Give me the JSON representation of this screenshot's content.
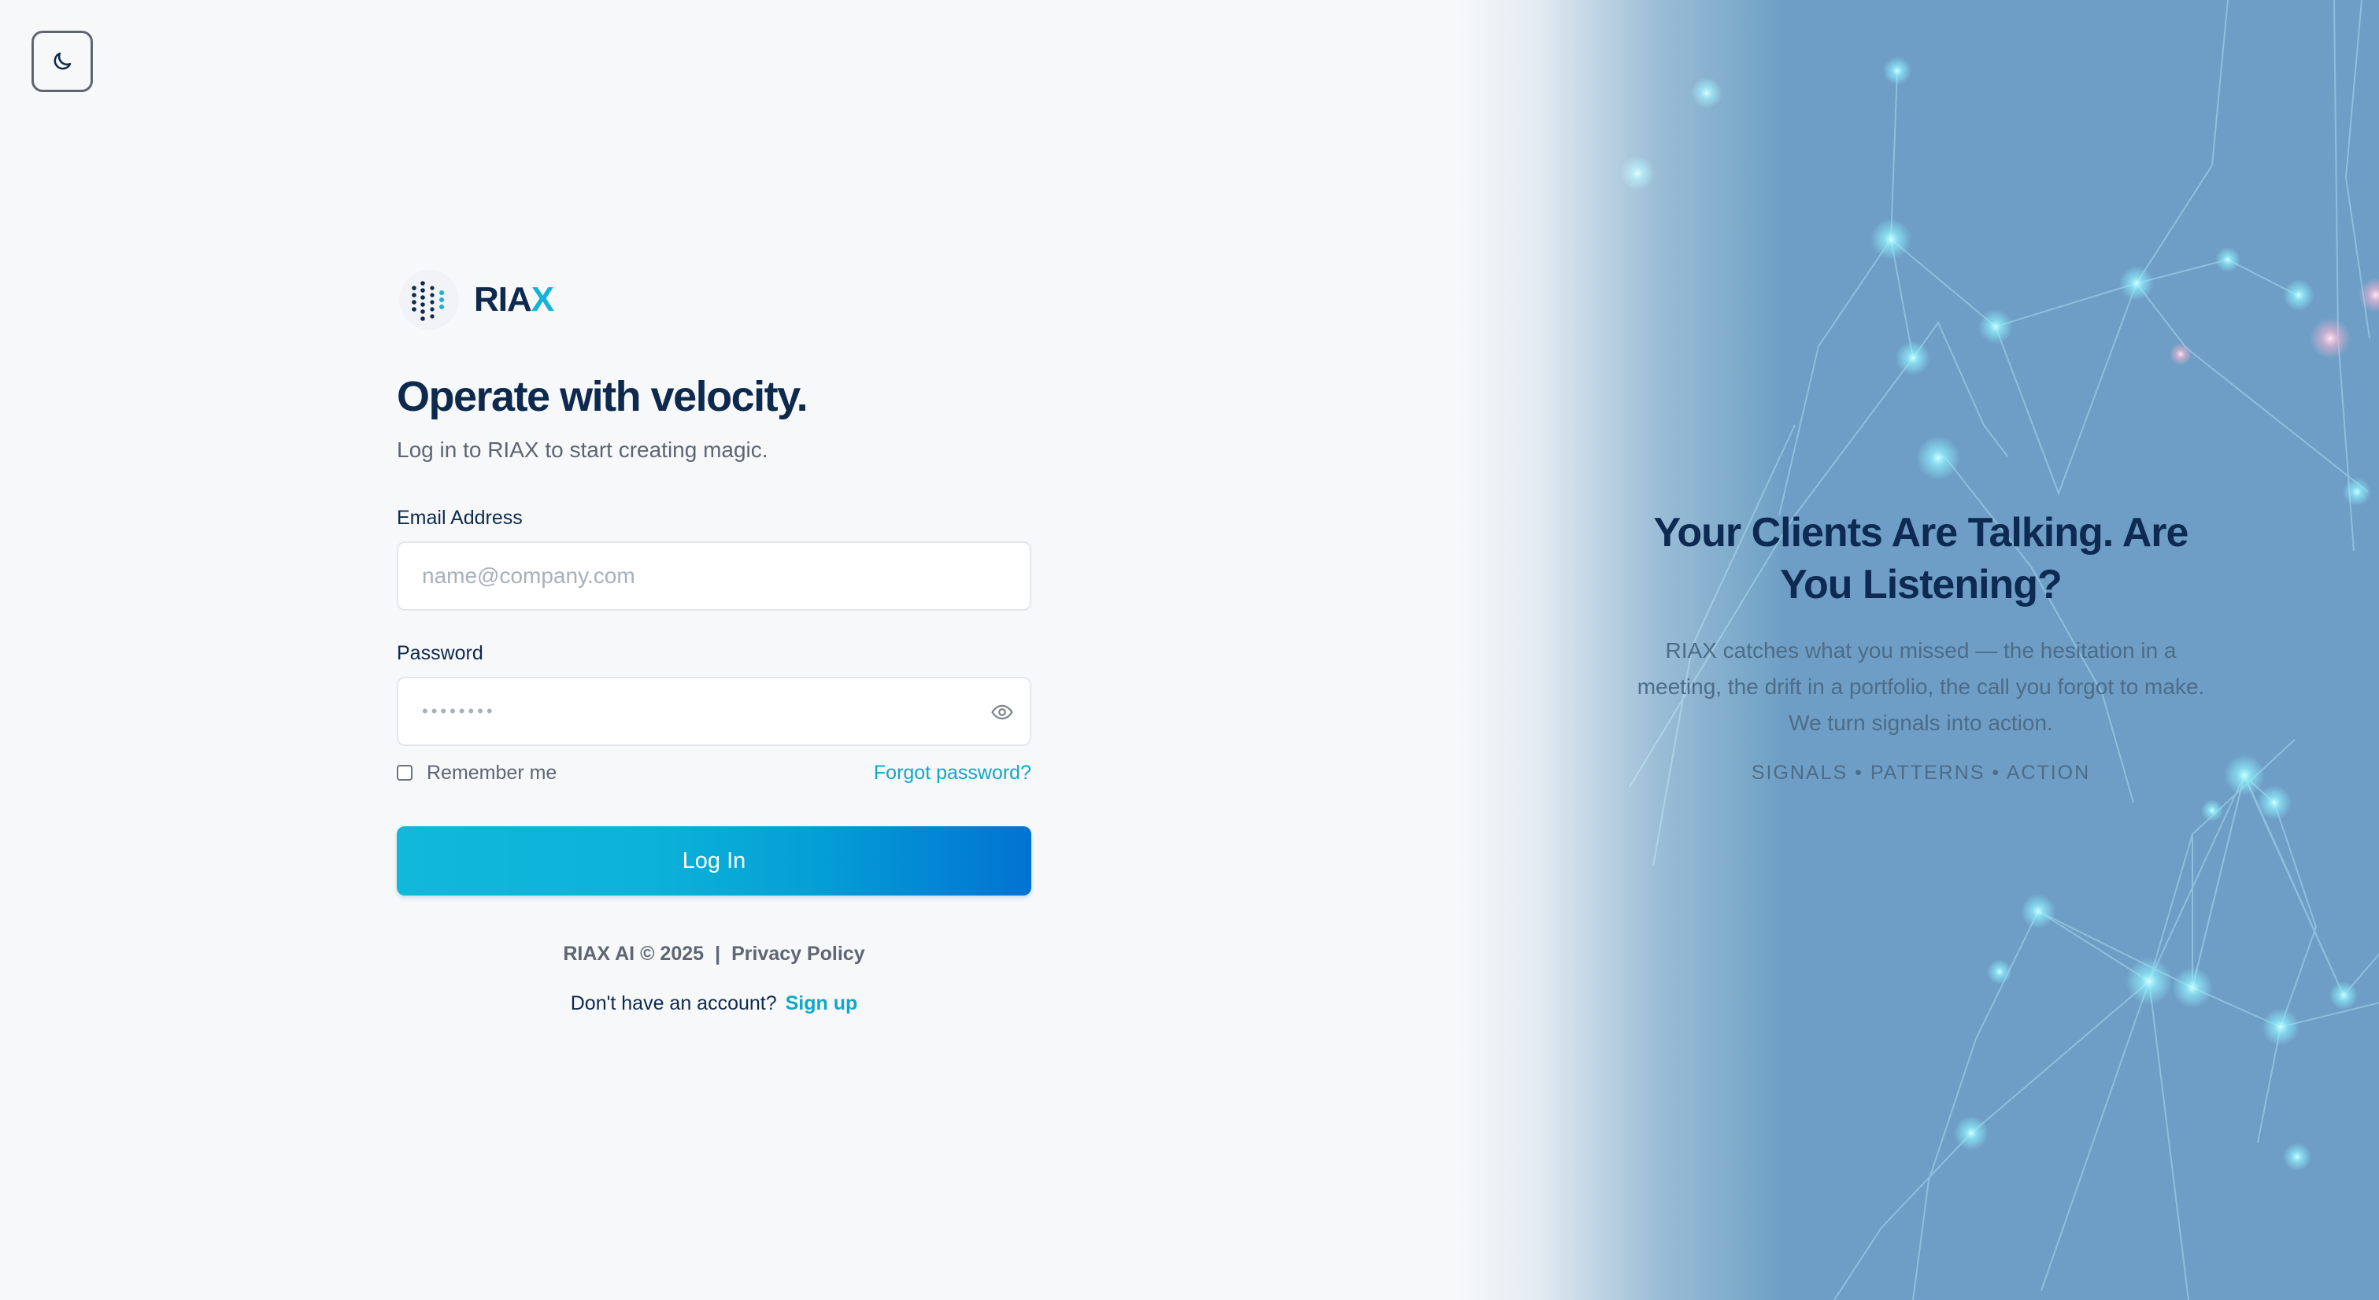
{
  "theme_toggle": {
    "icon": "moon-icon"
  },
  "brand": {
    "name_main": "RIA",
    "name_accent": "X",
    "logo_icon": "dot-grid-logo-icon"
  },
  "login": {
    "headline": "Operate with velocity.",
    "subtitle": "Log in to RIAX to start creating magic.",
    "email_label": "Email Address",
    "email_placeholder": "name@company.com",
    "password_label": "Password",
    "password_mask": "••••••••",
    "show_password_icon": "eye-icon",
    "remember_label": "Remember me",
    "remember_checked": false,
    "forgot_label": "Forgot password?",
    "submit_label": "Log In"
  },
  "footer": {
    "copyright": "RIAX AI © 2025",
    "separator": "|",
    "privacy_label": "Privacy Policy",
    "signup_prompt": "Don't have an account?",
    "signup_label": "Sign up"
  },
  "hero": {
    "title": "Your Clients Are Talking. Are You Listening?",
    "body": "RIAX catches what you missed — the hesitation in a meeting, the drift in a portfolio, the call you forgot to make. We turn signals into action.",
    "tags": "SIGNALS • PATTERNS • ACTION"
  },
  "colors": {
    "primary_navy": "#0d2a4e",
    "accent_cyan": "#12b3d8",
    "link": "#12a6c9",
    "button_gradient_start": "#12b8da",
    "button_gradient_end": "#0272d2",
    "hero_blue": "#77a9cc"
  }
}
